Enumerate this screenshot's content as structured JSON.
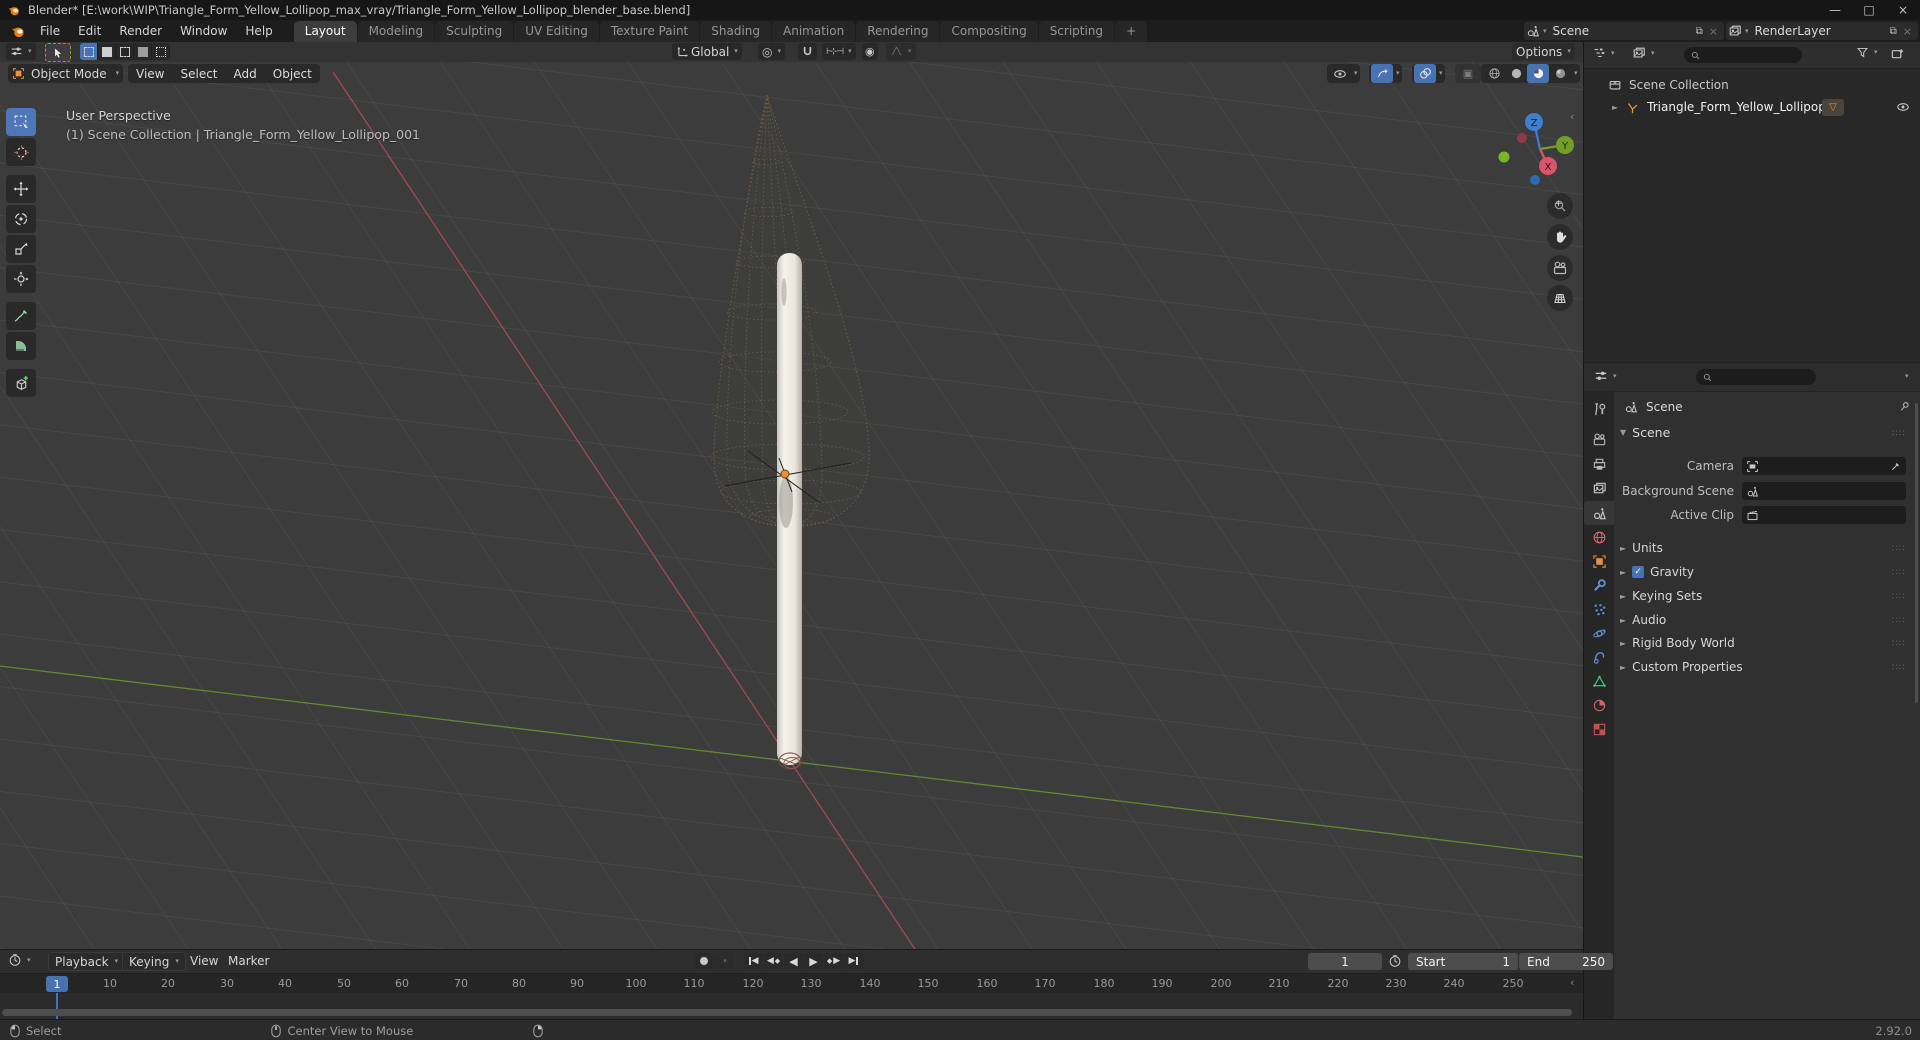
{
  "window": {
    "title": "Blender* [E:\\work\\WIP\\Triangle_Form_Yellow_Lollipop_max_vray/Triangle_Form_Yellow_Lollipop_blender_base.blend]",
    "minimize": "—",
    "maximize": "□",
    "close": "×"
  },
  "topbar": {
    "menus": [
      "File",
      "Edit",
      "Render",
      "Window",
      "Help"
    ],
    "tabs": [
      "Layout",
      "Modeling",
      "Sculpting",
      "UV Editing",
      "Texture Paint",
      "Shading",
      "Animation",
      "Rendering",
      "Compositing",
      "Scripting"
    ],
    "new_tab": "+",
    "scene_selector": {
      "value": "Scene"
    },
    "render_layer_selector": {
      "value": "RenderLayer"
    }
  },
  "tool_settings": {
    "orientation": "Global",
    "options": "Options"
  },
  "viewport": {
    "mode_selector": "Object Mode",
    "menus": [
      "View",
      "Select",
      "Add",
      "Object"
    ],
    "overlay": {
      "line1": "User Perspective",
      "line2": "(1) Scene Collection | Triangle_Form_Yellow_Lollipop_001"
    },
    "gizmo": {
      "z": "Z",
      "y": "Y",
      "x": "X"
    }
  },
  "outliner": {
    "scene_collection": "Scene Collection",
    "object_name": "Triangle_Form_Yellow_Lollipop"
  },
  "properties": {
    "breadcrumb": "Scene",
    "section_title": "Scene",
    "fields": [
      {
        "label": "Camera"
      },
      {
        "label": "Background Scene"
      },
      {
        "label": "Active Clip"
      }
    ],
    "sections": [
      "Units",
      "Gravity",
      "Keying Sets",
      "Audio",
      "Rigid Body World",
      "Custom Properties"
    ],
    "gravity_check": "✓"
  },
  "timeline": {
    "menus": [
      "Playback",
      "Keying",
      "View",
      "Marker"
    ],
    "current_frame": "1",
    "playhead_frame": "1",
    "start_label": "Start",
    "start_value": "1",
    "end_label": "End",
    "end_value": "250",
    "ruler": [
      "10",
      "20",
      "30",
      "40",
      "50",
      "60",
      "70",
      "80",
      "90",
      "100",
      "110",
      "120",
      "130",
      "140",
      "150",
      "160",
      "170",
      "180",
      "190",
      "200",
      "210",
      "220",
      "230",
      "240",
      "250"
    ]
  },
  "statusbar": {
    "left_hint": "Select",
    "middle_hint": "Center View to Mouse",
    "version": "2.92.0"
  },
  "colors": {
    "accent": "#4772b3",
    "axis_x": "#b14a5c",
    "axis_y": "#6d9d2c",
    "object_orange": "#e8913f"
  }
}
